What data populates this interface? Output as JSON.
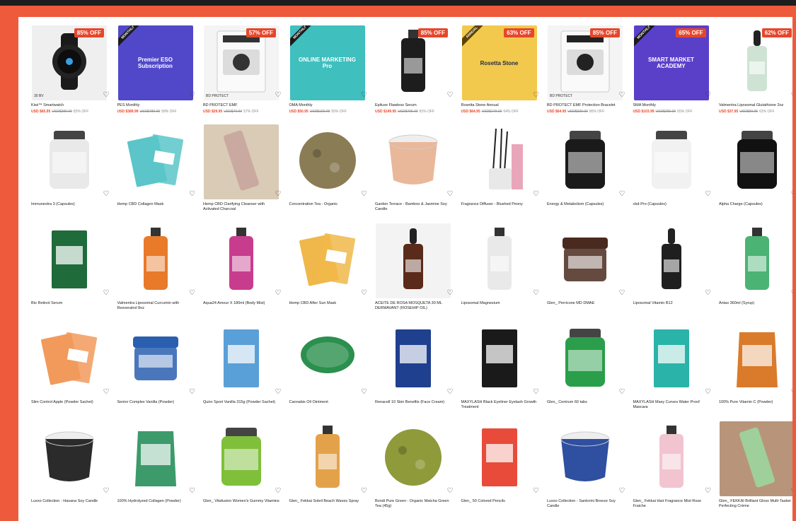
{
  "colors": {
    "frame": "#ee5a3c",
    "accent": "#e8462a",
    "panel": "#ffffff"
  },
  "rows": [
    [
      {
        "name": "Kiwi™ Smartwatch",
        "badge": "85% OFF",
        "tag": "",
        "label": "30 BV",
        "price": "USD $65.95",
        "was": "USD$380.00",
        "off": "83% OFF",
        "bg": "#efefef",
        "shape": "watch",
        "color": "#1a1a1a"
      },
      {
        "name": "PES Monthly",
        "badge": "",
        "tag": "MONTHLY",
        "label": "Premier ESO Subscription",
        "price": "USD $389.99",
        "was": "USD$489.99",
        "off": "58% OFF",
        "bg": "#5148c9",
        "shape": "text",
        "color": "#ffffff"
      },
      {
        "name": "BD PROTECT EMF",
        "badge": "57% OFF",
        "tag": "",
        "label": "BD PROTECT",
        "price": "USD $29.95",
        "was": "USD$70.00",
        "off": "57% OFF",
        "bg": "#f4f4f4",
        "shape": "pack",
        "color": "#333333"
      },
      {
        "name": "OMA Monthly",
        "badge": "",
        "tag": "MONTHLY",
        "label": "ONLINE MARKETING Pro",
        "price": "USD $50.95",
        "was": "USD$100.00",
        "off": "50% OFF",
        "bg": "#3fbfbe",
        "shape": "text",
        "color": "#ffffff"
      },
      {
        "name": "Epiluxe Flawless Serum",
        "badge": "85% OFF",
        "tag": "",
        "label": "",
        "price": "USD $149.95",
        "was": "USD$795.00",
        "off": "81% OFF",
        "bg": "#ffffff",
        "shape": "bottle",
        "color": "#1d1d1d"
      },
      {
        "name": "Rosetta Stone Annual",
        "badge": "63% OFF",
        "tag": "ANNUAL",
        "label": "Rosetta Stone",
        "price": "USD $64.95",
        "was": "USD$179.00",
        "off": "64% OFF",
        "bg": "#f2c94c",
        "shape": "text",
        "color": "#1f2a44"
      },
      {
        "name": "BD PROTECT EMF Protection Bracelet",
        "badge": "85% OFF",
        "tag": "",
        "label": "BD PROTECT",
        "price": "USD $64.95",
        "was": "USD$330.00",
        "off": "80% OFF",
        "bg": "#f4f4f4",
        "shape": "pack",
        "color": "#222222"
      },
      {
        "name": "SMA Monthly",
        "badge": "65% OFF",
        "tag": "MONTHLY",
        "label": "SMART MARKET ACADEMY",
        "price": "USD $103.99",
        "was": "USD$299.00",
        "off": "65% OFF",
        "bg": "#5a40c9",
        "shape": "text",
        "color": "#ffffff"
      },
      {
        "name": "Valmentra Liposomal Glutathione 2oz",
        "badge": "62% OFF",
        "tag": "",
        "label": "",
        "price": "USD $37.95",
        "was": "USD$99.95",
        "off": "62% OFF",
        "bg": "#ffffff",
        "shape": "dropper",
        "color": "#cfe3d4"
      }
    ],
    [
      {
        "name": "Immunextra 3 (Capsules)",
        "badge": "",
        "tag": "",
        "label": "",
        "price": "",
        "was": "",
        "off": "",
        "bg": "#ffffff",
        "shape": "jar",
        "color": "#e9e9e9"
      },
      {
        "name": "Hemp CBD Collagen Mask",
        "badge": "",
        "tag": "",
        "label": "",
        "price": "",
        "was": "",
        "off": "",
        "bg": "#ffffff",
        "shape": "mask",
        "color": "#5bc5c9"
      },
      {
        "name": "Hemp CBD Clarifying Cleanser with Activated Charcoal",
        "badge": "",
        "tag": "",
        "label": "",
        "price": "",
        "was": "",
        "off": "",
        "bg": "#d9cbb6",
        "shape": "tube",
        "color": "#caa9a0"
      },
      {
        "name": "Concentration Tea - Organic",
        "badge": "",
        "tag": "",
        "label": "",
        "price": "",
        "was": "",
        "off": "",
        "bg": "#ffffff",
        "shape": "tea",
        "color": "#8a7c55"
      },
      {
        "name": "Garden Terrace - Bamboo & Jasmine Soy Candle",
        "badge": "",
        "tag": "",
        "label": "",
        "price": "",
        "was": "",
        "off": "",
        "bg": "#ffffff",
        "shape": "candle",
        "color": "#e9b89a"
      },
      {
        "name": "Fragrance Diffuser - Blushed Peony",
        "badge": "",
        "tag": "",
        "label": "",
        "price": "",
        "was": "",
        "off": "",
        "bg": "#ffffff",
        "shape": "diffuser",
        "color": "#e9a6bb"
      },
      {
        "name": "Energy & Metabolism (Capsules)",
        "badge": "",
        "tag": "",
        "label": "",
        "price": "",
        "was": "",
        "off": "",
        "bg": "#ffffff",
        "shape": "jar",
        "color": "#1a1a1a"
      },
      {
        "name": "cbd-Pro (Capsules)",
        "badge": "",
        "tag": "",
        "label": "",
        "price": "",
        "was": "",
        "off": "",
        "bg": "#ffffff",
        "shape": "jar",
        "color": "#f1f1f1"
      },
      {
        "name": "Alpha Charge (Capsules)",
        "badge": "",
        "tag": "",
        "label": "",
        "price": "",
        "was": "",
        "off": "",
        "bg": "#ffffff",
        "shape": "jar",
        "color": "#111111"
      }
    ],
    [
      {
        "name": "Bio Retinol Serum",
        "badge": "",
        "tag": "",
        "label": "",
        "price": "",
        "was": "",
        "off": "",
        "bg": "#ffffff",
        "shape": "box",
        "color": "#1f6b3a"
      },
      {
        "name": "Valmentra Liposomal Curcumin with Resveratrol 8oz",
        "badge": "",
        "tag": "",
        "label": "",
        "price": "",
        "was": "",
        "off": "",
        "bg": "#ffffff",
        "shape": "bottle",
        "color": "#e87a2a"
      },
      {
        "name": "Aqua24 Amour X 180ml (Body Mist)",
        "badge": "",
        "tag": "",
        "label": "",
        "price": "",
        "was": "",
        "off": "",
        "bg": "#ffffff",
        "shape": "bottle",
        "color": "#c83c8e"
      },
      {
        "name": "Hemp CBD After Sun Mask",
        "badge": "",
        "tag": "",
        "label": "",
        "price": "",
        "was": "",
        "off": "",
        "bg": "#ffffff",
        "shape": "mask",
        "color": "#f0b84a"
      },
      {
        "name": "ACEITE DE ROSA MOSQUETA 30 ML DERMAVANT (ROSEHIP OIL)",
        "badge": "",
        "tag": "",
        "label": "",
        "price": "",
        "was": "",
        "off": "",
        "bg": "#f3f3f3",
        "shape": "dropper",
        "color": "#5a2a1a"
      },
      {
        "name": "Liposomal Magnesium",
        "badge": "",
        "tag": "",
        "label": "",
        "price": "",
        "was": "",
        "off": "",
        "bg": "#ffffff",
        "shape": "bottle",
        "color": "#e9e9e9"
      },
      {
        "name": "Glen_ Perricone MD DMAE",
        "badge": "",
        "tag": "",
        "label": "",
        "price": "",
        "was": "",
        "off": "",
        "bg": "#ffffff",
        "shape": "pot",
        "color": "#4a2a1e"
      },
      {
        "name": "Liposomal Vitamin B12",
        "badge": "",
        "tag": "",
        "label": "",
        "price": "",
        "was": "",
        "off": "",
        "bg": "#ffffff",
        "shape": "dropper",
        "color": "#1f1f1f"
      },
      {
        "name": "Antax 360ml (Syrup)",
        "badge": "",
        "tag": "",
        "label": "",
        "price": "",
        "was": "",
        "off": "",
        "bg": "#ffffff",
        "shape": "bottle",
        "color": "#4bb373"
      }
    ],
    [
      {
        "name": "Slim Control Apple (Powder Sachet)",
        "badge": "",
        "tag": "",
        "label": "",
        "price": "",
        "was": "",
        "off": "",
        "bg": "#ffffff",
        "shape": "mask",
        "color": "#f29a5c"
      },
      {
        "name": "Senior Complex Vanilla (Powder)",
        "badge": "",
        "tag": "",
        "label": "",
        "price": "",
        "was": "",
        "off": "",
        "bg": "#ffffff",
        "shape": "pot",
        "color": "#2a5fb0"
      },
      {
        "name": "Quiro Sport Vanilla 315g (Powder Sachet)",
        "badge": "",
        "tag": "",
        "label": "",
        "price": "",
        "was": "",
        "off": "",
        "bg": "#ffffff",
        "shape": "box",
        "color": "#5aa0d8"
      },
      {
        "name": "Cannabis Oil Ointment",
        "badge": "",
        "tag": "",
        "label": "",
        "price": "",
        "was": "",
        "off": "",
        "bg": "#ffffff",
        "shape": "tin",
        "color": "#2b8f4e"
      },
      {
        "name": "Renacell 10 Skin Benefits (Face Cream)",
        "badge": "",
        "tag": "",
        "label": "",
        "price": "",
        "was": "",
        "off": "",
        "bg": "#ffffff",
        "shape": "box",
        "color": "#1f3f8f"
      },
      {
        "name": "MAXYLASH Black Eyeliner Eyelash Growth Treatment",
        "badge": "",
        "tag": "",
        "label": "",
        "price": "",
        "was": "",
        "off": "",
        "bg": "#ffffff",
        "shape": "box",
        "color": "#1a1a1a"
      },
      {
        "name": "Glen_ Centrum 60 tabs",
        "badge": "",
        "tag": "",
        "label": "",
        "price": "",
        "was": "",
        "off": "",
        "bg": "#ffffff",
        "shape": "jar",
        "color": "#2a9e4a"
      },
      {
        "name": "MAXYLASH Maxy Curves Water Proof Mascara",
        "badge": "",
        "tag": "",
        "label": "",
        "price": "",
        "was": "",
        "off": "",
        "bg": "#ffffff",
        "shape": "box",
        "color": "#2ab3a8"
      },
      {
        "name": "100% Pure Vitamin C (Powder)",
        "badge": "",
        "tag": "",
        "label": "",
        "price": "",
        "was": "",
        "off": "",
        "bg": "#ffffff",
        "shape": "pouch",
        "color": "#d97b2a"
      }
    ],
    [
      {
        "name": "Luxxo Collection - Havana Soy Candle",
        "badge": "",
        "tag": "",
        "label": "",
        "price": "",
        "was": "",
        "off": "",
        "bg": "#ffffff",
        "shape": "candle",
        "color": "#2b2b2b"
      },
      {
        "name": "100% Hydrolyzed Collagen (Powder)",
        "badge": "",
        "tag": "",
        "label": "",
        "price": "",
        "was": "",
        "off": "",
        "bg": "#ffffff",
        "shape": "pouch",
        "color": "#3c9a6b"
      },
      {
        "name": "Glen_ Vitafusion Women's Gummy Vitamins",
        "badge": "",
        "tag": "",
        "label": "",
        "price": "",
        "was": "",
        "off": "",
        "bg": "#ffffff",
        "shape": "jar",
        "color": "#7fbf3a"
      },
      {
        "name": "Glen_ Fekkai Soleil Beach Waves Spray",
        "badge": "",
        "tag": "",
        "label": "",
        "price": "",
        "was": "",
        "off": "",
        "bg": "#ffffff",
        "shape": "bottle",
        "color": "#e3a24a"
      },
      {
        "name": "Bondi Pure Green - Organic Matcha Green Tea (45g)",
        "badge": "",
        "tag": "",
        "label": "",
        "price": "",
        "was": "",
        "off": "",
        "bg": "#ffffff",
        "shape": "tea",
        "color": "#8f9a3a"
      },
      {
        "name": "Glen_ 50 Colored Pencils",
        "badge": "",
        "tag": "",
        "label": "",
        "price": "",
        "was": "",
        "off": "",
        "bg": "#ffffff",
        "shape": "box",
        "color": "#e94b3a"
      },
      {
        "name": "Luxxo Collection - Santorini Breeze Soy Candle",
        "badge": "",
        "tag": "",
        "label": "",
        "price": "",
        "was": "",
        "off": "",
        "bg": "#ffffff",
        "shape": "candle",
        "color": "#2f4fa0"
      },
      {
        "name": "Glen_ Fekkai Hair Fragrance Mist Rose Fraiche",
        "badge": "",
        "tag": "",
        "label": "",
        "price": "",
        "was": "",
        "off": "",
        "bg": "#ffffff",
        "shape": "bottle",
        "color": "#f2c4d0"
      },
      {
        "name": "Glen_ FEKKAI Brilliant Gloss Multi-Tasker Perfecting Crème",
        "badge": "",
        "tag": "",
        "label": "",
        "price": "",
        "was": "",
        "off": "",
        "bg": "#b8957a",
        "shape": "tube",
        "color": "#9fcf9a"
      }
    ]
  ]
}
